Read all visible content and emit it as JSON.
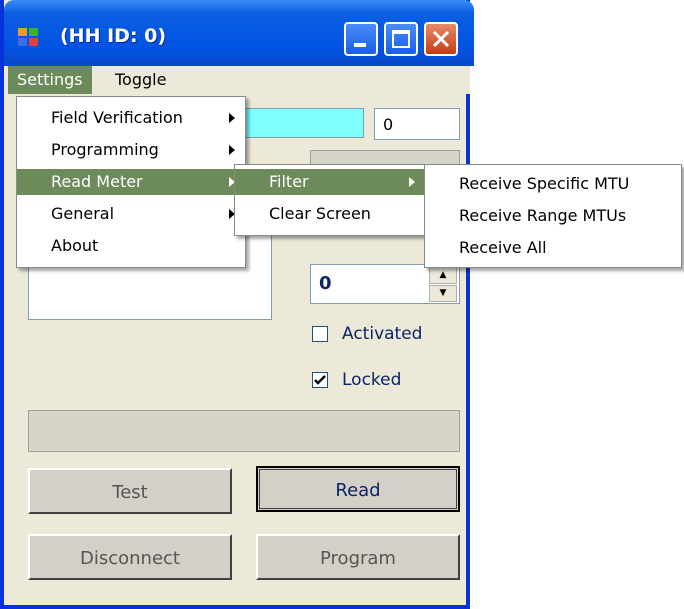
{
  "window": {
    "title": "(HH ID: 0)"
  },
  "menubar": {
    "items": [
      "Settings",
      "Toggle"
    ]
  },
  "settings_menu": {
    "items": [
      {
        "label": "Field Verification"
      },
      {
        "label": "Programming"
      },
      {
        "label": "Read Meter"
      },
      {
        "label": "General"
      },
      {
        "label": "About"
      }
    ]
  },
  "read_meter_menu": {
    "items": [
      {
        "label": "Filter"
      },
      {
        "label": "Clear Screen"
      }
    ]
  },
  "filter_menu": {
    "items": [
      {
        "label": "Receive Specific MTU"
      },
      {
        "label": "Receive Range MTUs"
      },
      {
        "label": "Receive All"
      }
    ]
  },
  "form": {
    "top_number_value": "0",
    "spinner_value": "0",
    "activated": {
      "label": "Activated",
      "checked": false
    },
    "locked": {
      "label": "Locked",
      "checked": true
    },
    "buttons": {
      "test": "Test",
      "read": "Read",
      "disconnect": "Disconnect",
      "program": "Program"
    }
  },
  "colors": {
    "menu_highlight": "#6d8a5a",
    "cyan_field": "#80ffff",
    "titlebar": "#0054e3"
  }
}
